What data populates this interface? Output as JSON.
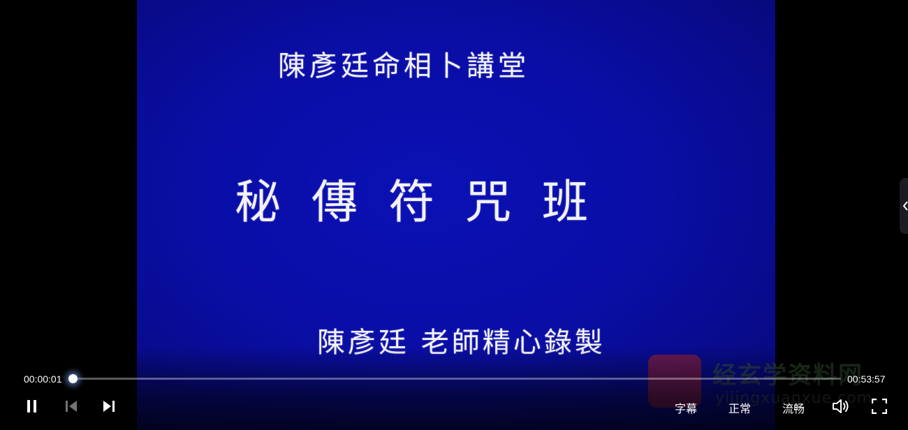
{
  "video": {
    "lecture_hall": "陳彥廷命相卜講堂",
    "course_title": "秘傳符咒班",
    "credit": "陳彥廷 老師精心錄製"
  },
  "player": {
    "current_time": "00:00:01",
    "duration": "00:53:57",
    "progress_fraction": 0.0003,
    "subtitle_label": "字幕",
    "speed_label": "正常",
    "quality_label": "流畅",
    "icons": {
      "pause": "pause-icon",
      "previous": "skip-previous-icon",
      "next": "skip-next-icon",
      "volume": "volume-icon",
      "fullscreen": "fullscreen-icon",
      "side_tab": "chevron-left-icon"
    }
  },
  "watermark": {
    "site_name": "经玄学资料网",
    "site_domain": "yijingxuanxue.com"
  },
  "colors": {
    "video_background": "#0a0ea6",
    "text": "#ffffff",
    "progress_glow": "#78aaff"
  }
}
